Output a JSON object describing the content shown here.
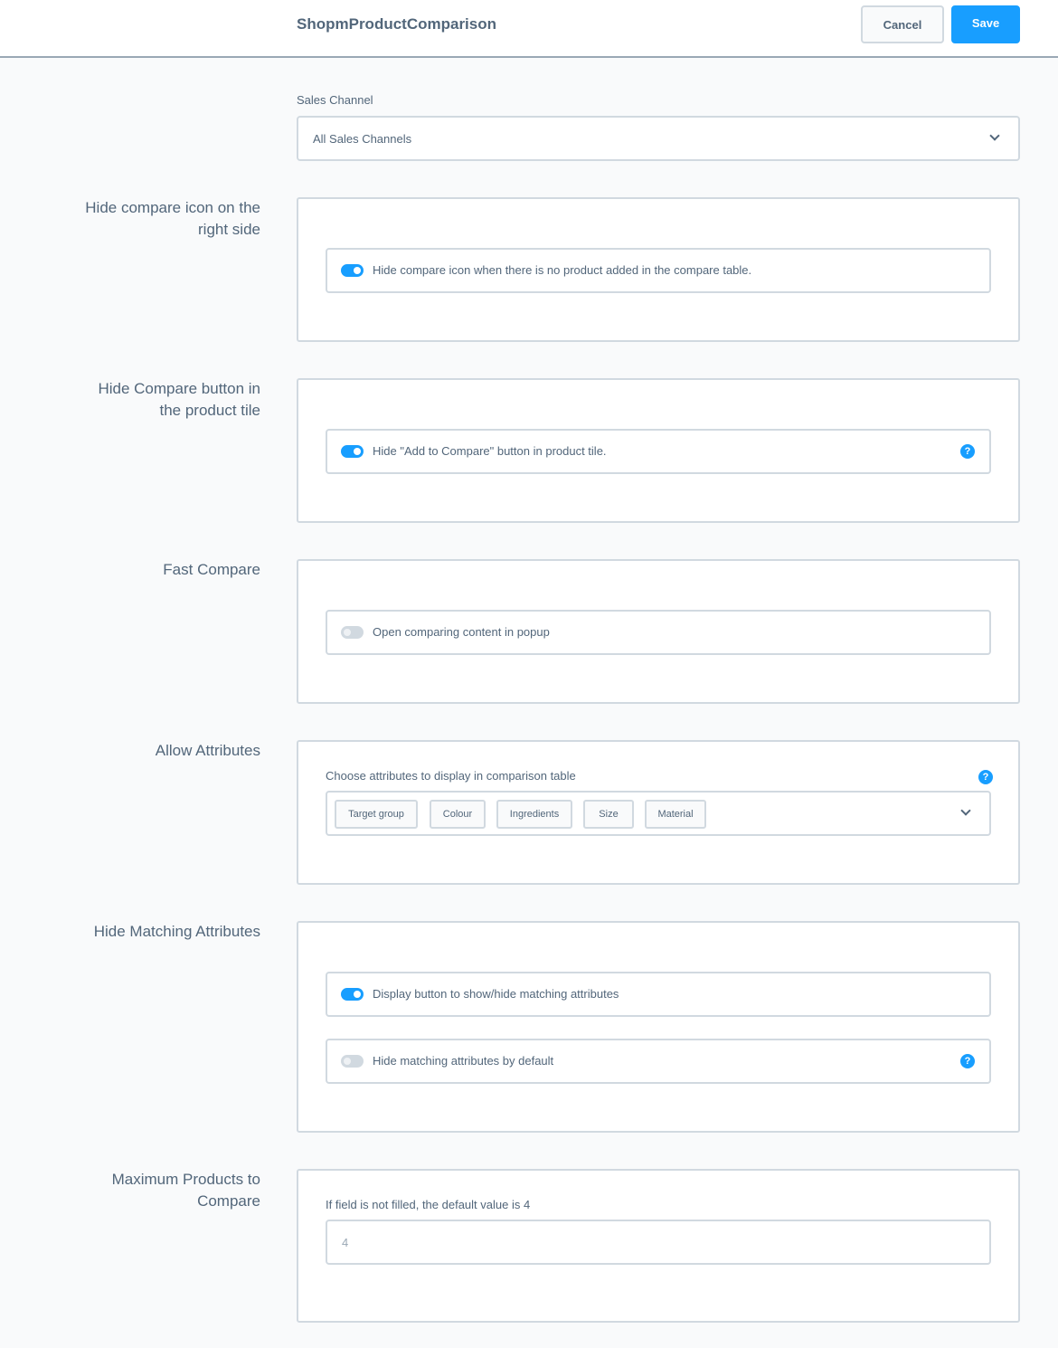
{
  "header": {
    "title": "ShopmProductComparison",
    "cancel_label": "Cancel",
    "save_label": "Save"
  },
  "sales_channel": {
    "label": "Sales Channel",
    "selected": "All Sales Channels"
  },
  "sections": {
    "hide_compare_icon": {
      "label_line1": "Hide compare icon on the",
      "label_line2": "right side",
      "toggle_label": "Hide compare icon when there is no product added in the compare table.",
      "enabled": true
    },
    "hide_compare_button": {
      "label_line1": "Hide Compare button in",
      "label_line2": "the product tile",
      "toggle_label": "Hide \"Add to Compare\" button in product tile.",
      "enabled": true,
      "help_icon": "?"
    },
    "fast_compare": {
      "label": "Fast Compare",
      "toggle_label": "Open comparing content in popup",
      "enabled": false
    },
    "allow_attributes": {
      "label": "Allow Attributes",
      "hint": "Choose attributes to display in comparison table",
      "help_icon": "?",
      "selected_tags": [
        "Target group",
        "Colour",
        "Ingredients",
        "Size",
        "Material"
      ]
    },
    "hide_matching_attributes": {
      "label": "Hide Matching Attributes",
      "toggles": [
        {
          "label": "Display button to show/hide matching attributes",
          "enabled": true
        },
        {
          "label": "Hide matching attributes by default",
          "enabled": false,
          "help_icon": "?"
        }
      ]
    },
    "max_products": {
      "label_line1": "Maximum Products to",
      "label_line2": "Compare",
      "hint": "If field is not filled, the default value is 4",
      "placeholder": "4",
      "value": ""
    }
  },
  "colors": {
    "accent": "#189eff",
    "text": "#52667a",
    "border": "#d1d9e0",
    "background": "#f9fafb"
  }
}
